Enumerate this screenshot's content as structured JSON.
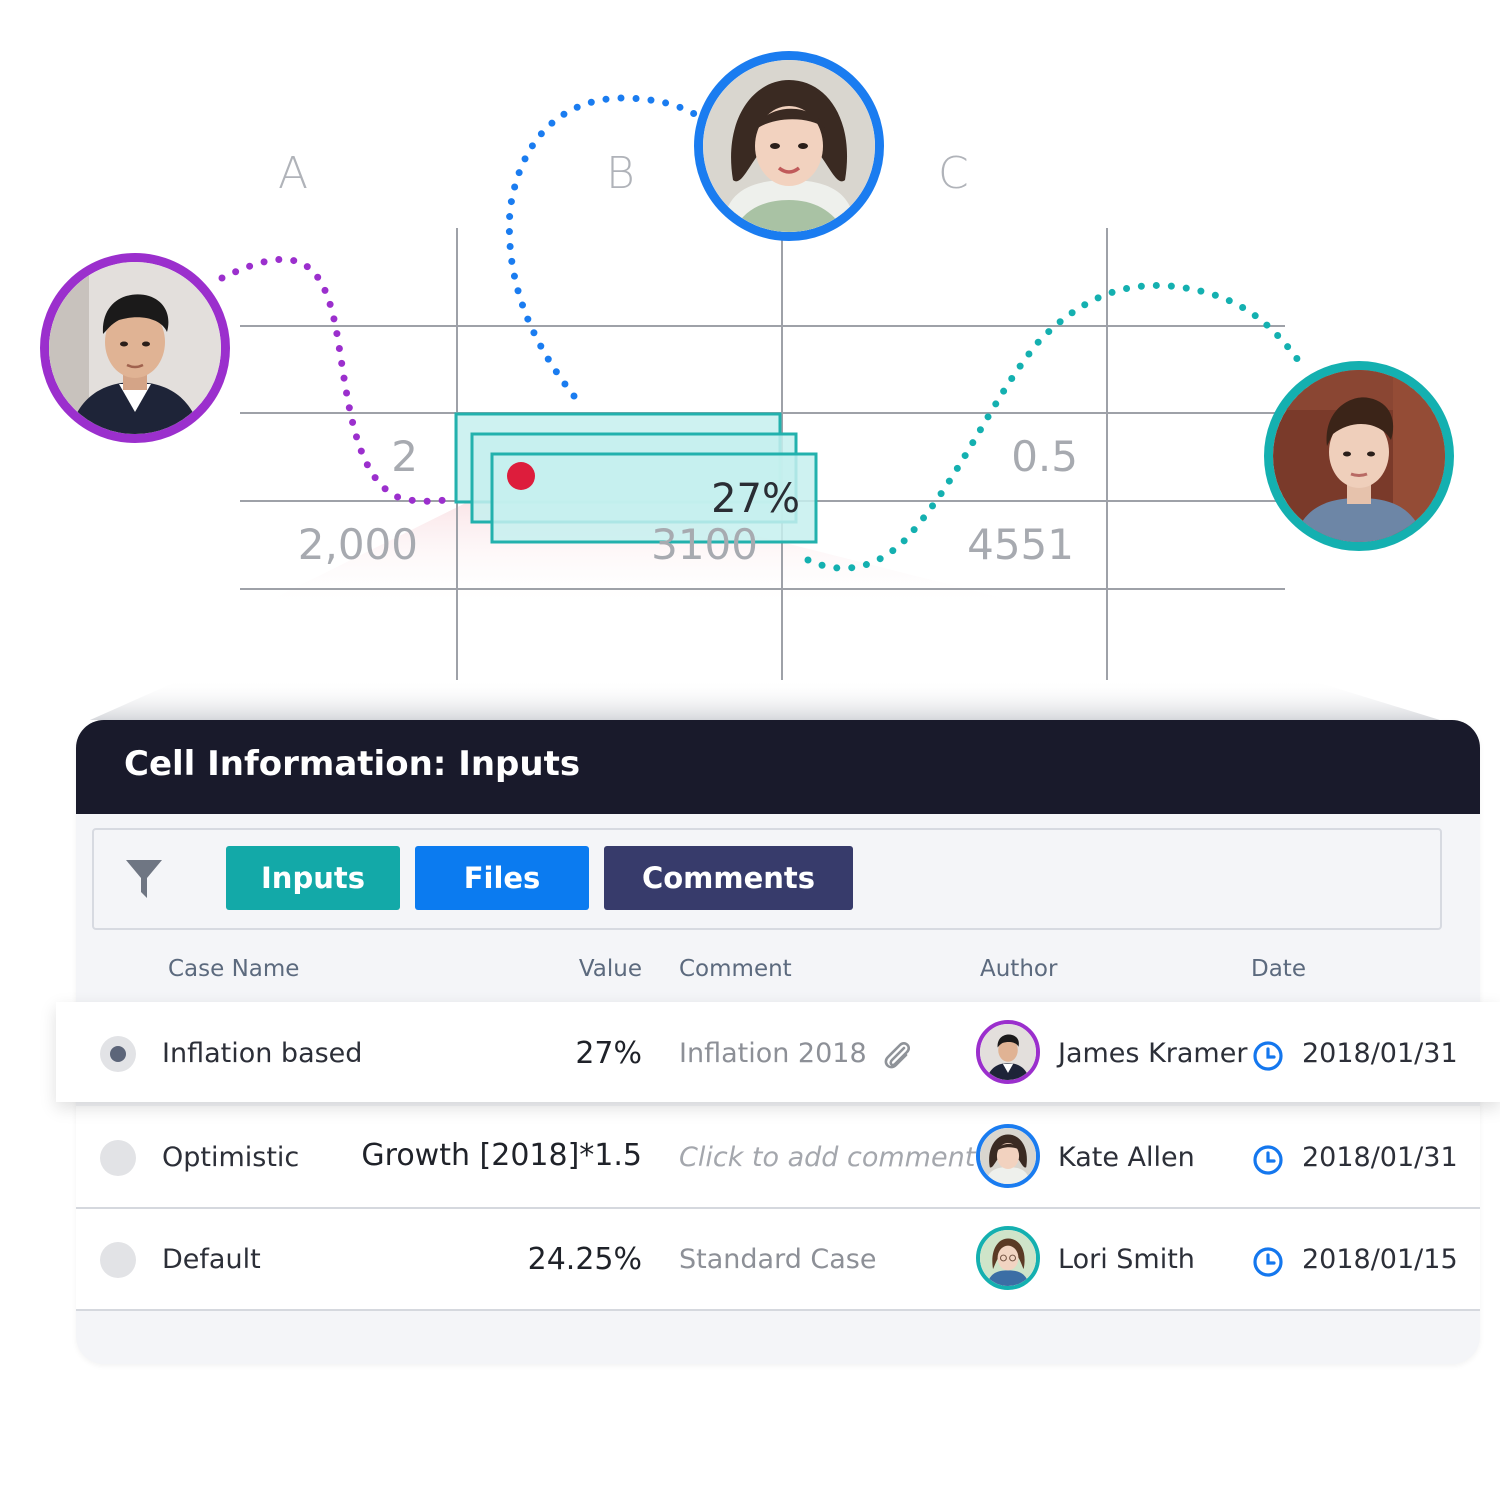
{
  "spreadsheet": {
    "columns": [
      "A",
      "B",
      "C"
    ],
    "cells": {
      "row1_a": "2",
      "row1_c": "0.5",
      "row2_a": "2,000",
      "row2_b": "3100",
      "row2_c": "4551"
    },
    "selected_value": "27%"
  },
  "collaborators": [
    {
      "avatar": "male-avatar",
      "ring_color": "#9b2fcd"
    },
    {
      "avatar": "female-avatar",
      "ring_color": "#1a7cf0"
    },
    {
      "avatar": "female-avatar-short-hair",
      "ring_color": "#14b0b0"
    }
  ],
  "panel": {
    "title": "Cell Information: Inputs",
    "filter_icon": "funnel-icon",
    "tabs": [
      {
        "label": "Inputs",
        "color": "#13a9a8"
      },
      {
        "label": "Files",
        "color": "#0b7bf0"
      },
      {
        "label": "Comments",
        "color": "#373b6b"
      }
    ],
    "columns": [
      "Case Name",
      "Value",
      "Comment",
      "Author",
      "Date"
    ],
    "rows": [
      {
        "case_name": "Inflation based",
        "value": "27%",
        "comment": "Inflation 2018",
        "comment_icon": "paperclip-icon",
        "author": "James Kramer",
        "date": "2018/01/31",
        "selected": true
      },
      {
        "case_name": "Optimistic",
        "value": "Growth [2018]*1.5",
        "comment": "Click to add comment",
        "author": "Kate Allen",
        "date": "2018/01/31",
        "selected": false
      },
      {
        "case_name": "Default",
        "value": "24.25%",
        "comment": "Standard Case",
        "author": "Lori Smith",
        "date": "2018/01/15",
        "selected": false
      }
    ]
  }
}
